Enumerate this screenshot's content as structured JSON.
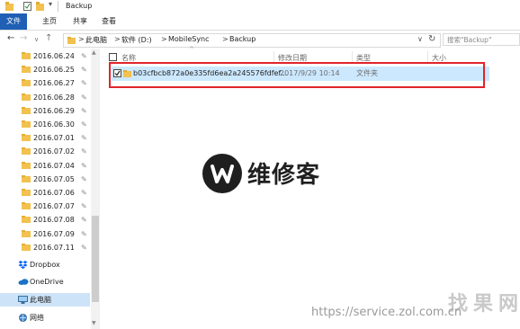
{
  "window": {
    "title": "Backup"
  },
  "ribbon": {
    "tabs": [
      "文件",
      "主页",
      "共享",
      "查看"
    ]
  },
  "address": {
    "crumbs": [
      "此电脑",
      "软件 (D:)",
      "MobileSync",
      "Backup"
    ],
    "separator": ">",
    "search_placeholder": "搜索\"Backup\""
  },
  "nav": {
    "quick_access": [
      "2016.06.24",
      "2016.06.25",
      "2016.06.27",
      "2016.06.28",
      "2016.06.29",
      "2016.06.30",
      "2016.07.01",
      "2016.07.02",
      "2016.07.04",
      "2016.07.05",
      "2016.07.06",
      "2016.07.07",
      "2016.07.08",
      "2016.07.09",
      "2016.07.11"
    ],
    "dropbox": "Dropbox",
    "onedrive": "OneDrive",
    "this_pc": "此电脑",
    "network": "网络",
    "pin_glyph": "📌"
  },
  "columns": {
    "name": "名称",
    "date": "修改日期",
    "type": "类型",
    "size": "大小"
  },
  "files": [
    {
      "name": "b03cfbcb872a0e335fd6ea2a245576fdfef...",
      "date": "2017/9/29 10:14",
      "type": "文件夹",
      "size": ""
    }
  ],
  "watermark": {
    "brand": "维修客",
    "url": "https://service.zol.com.cn",
    "site": "找果网"
  },
  "colors": {
    "file_tab": "#1f5fb5",
    "selection": "#cce8ff",
    "highlight_border": "#e0242b",
    "folder": "#f2c14e"
  }
}
